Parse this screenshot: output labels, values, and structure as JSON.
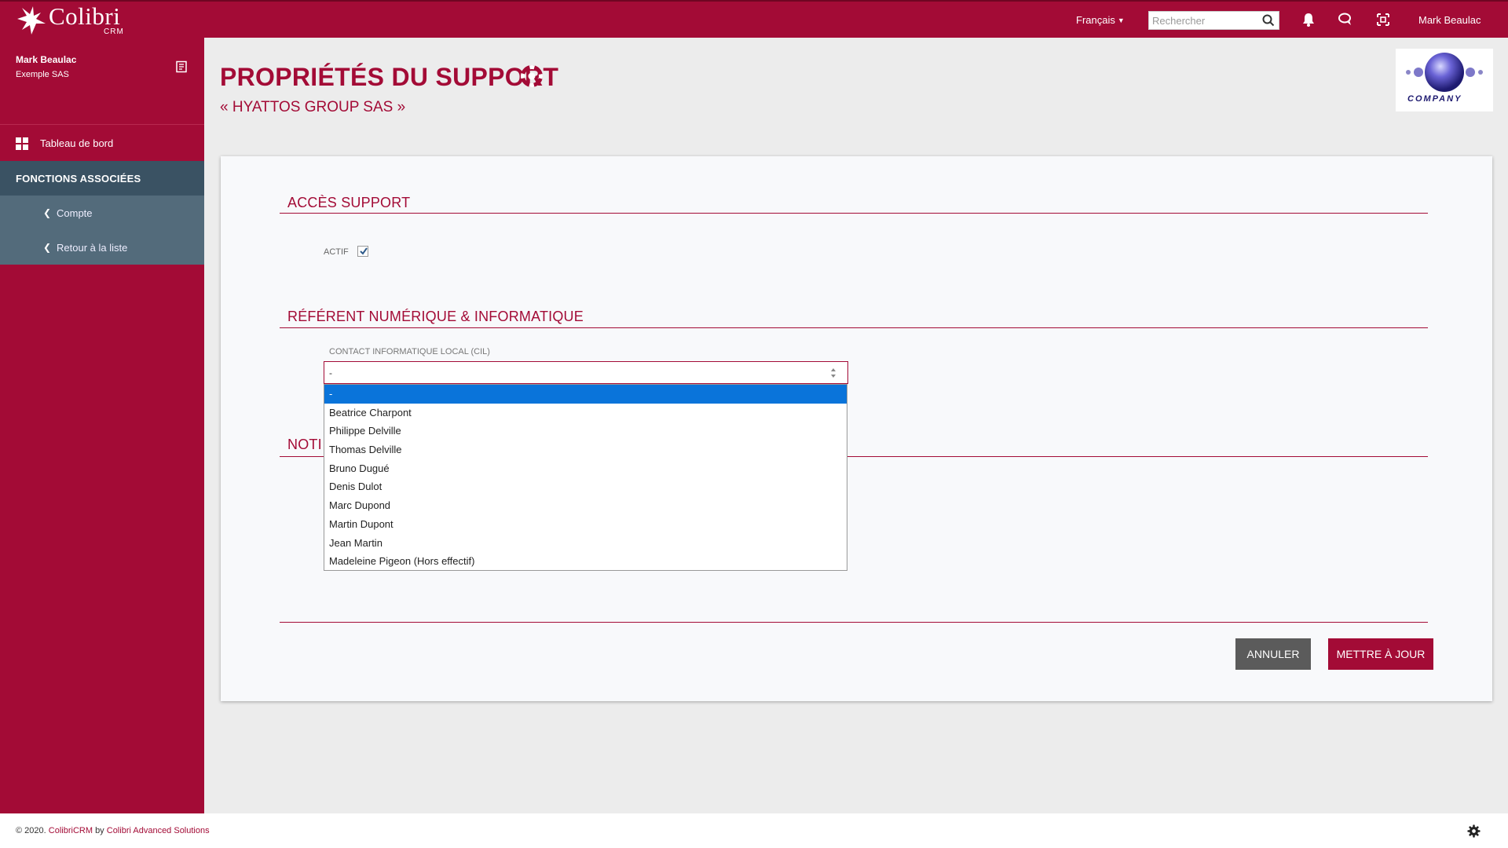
{
  "topbar": {
    "logo_text": "Colibri",
    "logo_sub": "CRM",
    "language": "Français",
    "search_placeholder": "Rechercher",
    "user_name": "Mark Beaulac"
  },
  "sidebar": {
    "user_name": "Mark Beaulac",
    "company": "Exemple SAS",
    "dashboard_label": "Tableau de bord",
    "section_label": "FONCTIONS ASSOCIÉES",
    "links": [
      {
        "label": "Compte"
      },
      {
        "label": "Retour à la liste"
      }
    ]
  },
  "header": {
    "title": "PROPRIÉTÉS DU SUPPORT",
    "subtitle": "« HYATTOS GROUP SAS »",
    "company_logo_text": "COMPANY"
  },
  "form": {
    "section1_title": "ACCÈS SUPPORT",
    "actif_label": "ACTIF",
    "actif_checked": true,
    "section2_title": "RÉFÉRENT NUMÉRIQUE & INFORMATIQUE",
    "cil_label": "CONTACT INFORMATIQUE LOCAL (CIL)",
    "cil_value": "-",
    "cil_options": [
      "-",
      "Beatrice Charpont",
      "Philippe Delville",
      "Thomas Delville",
      "Bruno Dugué",
      "Denis Dulot",
      "Marc Dupond",
      "Martin Dupont",
      "Jean Martin",
      "Madeleine Pigeon (Hors effectif)"
    ],
    "section3_title_visible": "NOTI",
    "cancel_label": "ANNULER",
    "update_label": "METTRE À JOUR"
  },
  "footer": {
    "prefix": "© 2020.",
    "product": "ColibriCRM",
    "by": "by",
    "vendor": "Colibri Advanced Solutions"
  },
  "colors": {
    "brand": "#a30b36",
    "sidebar_section": "#3a5263",
    "sidebar_link": "#536b7b",
    "selected_option": "#0a74da"
  }
}
